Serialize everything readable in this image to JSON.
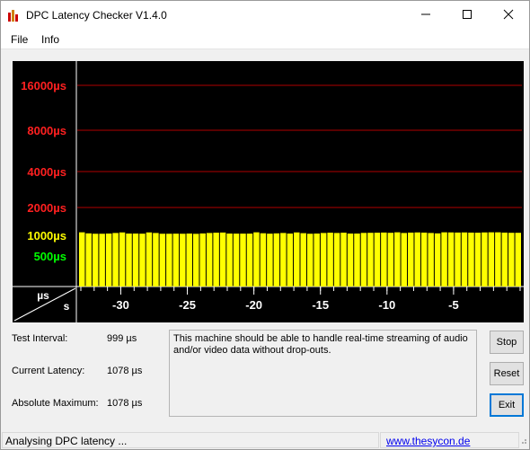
{
  "window": {
    "title": "DPC Latency Checker V1.4.0"
  },
  "menu": [
    "File",
    "Info"
  ],
  "chart_data": {
    "type": "bar",
    "ylabel": "µs",
    "xlabel": "s",
    "y_ticks": [
      {
        "label": "16000µs",
        "color": "#ff2020"
      },
      {
        "label": "8000µs",
        "color": "#ff2020"
      },
      {
        "label": "4000µs",
        "color": "#ff2020"
      },
      {
        "label": "2000µs",
        "color": "#ff2020"
      },
      {
        "label": "1000µs",
        "color": "#ffff00"
      },
      {
        "label": "500µs",
        "color": "#00ff00"
      }
    ],
    "x_ticks": [
      "-30",
      "-25",
      "-20",
      "-15",
      "-10",
      "-5"
    ],
    "bar_color": "#ffff00",
    "values": [
      1078,
      1050,
      1040,
      1040,
      1045,
      1060,
      1075,
      1045,
      1045,
      1042,
      1075,
      1060,
      1040,
      1040,
      1042,
      1040,
      1045,
      1038,
      1048,
      1060,
      1068,
      1072,
      1045,
      1043,
      1043,
      1043,
      1078,
      1053,
      1042,
      1050,
      1060,
      1045,
      1075,
      1055,
      1040,
      1045,
      1060,
      1068,
      1060,
      1068,
      1045,
      1045,
      1062,
      1065,
      1068,
      1072,
      1065,
      1078,
      1060,
      1070,
      1075,
      1070,
      1060,
      1050,
      1078,
      1075,
      1072,
      1075,
      1070,
      1068,
      1075,
      1078,
      1078,
      1070,
      1065,
      1065
    ],
    "grid_color": "#b00000"
  },
  "info": [
    {
      "label": "Test Interval:",
      "value": "999 µs"
    },
    {
      "label": "Current Latency:",
      "value": "1078 µs"
    },
    {
      "label": "Absolute Maximum:",
      "value": "1078 µs"
    }
  ],
  "message": "This machine should be able to handle real-time streaming of audio and/or video data without drop-outs.",
  "buttons": {
    "stop": "Stop",
    "reset": "Reset",
    "exit": "Exit"
  },
  "status": {
    "text": "Analysing DPC latency ...",
    "link": "www.thesycon.de"
  }
}
